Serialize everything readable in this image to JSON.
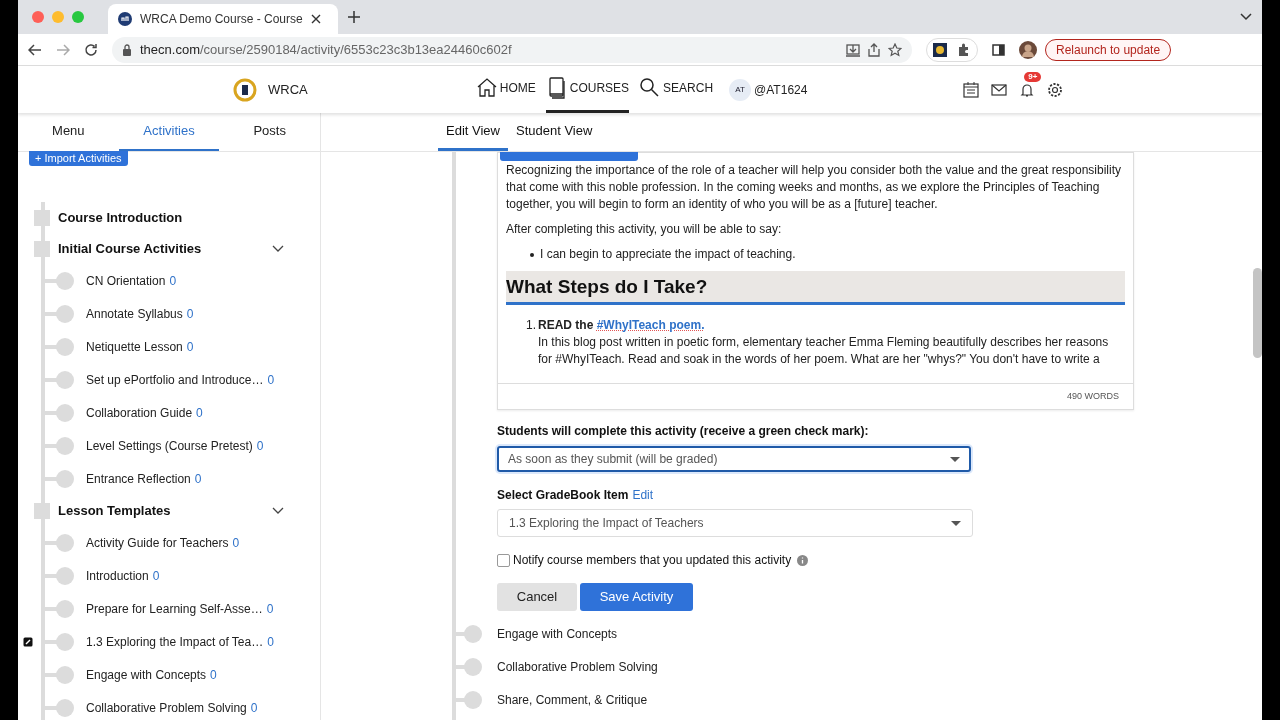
{
  "browser": {
    "tab_title": "WRCA Demo Course - Course",
    "url_host": "thecn.com",
    "url_path": "/course/2590184/activity/6553c23c3b13ea24460c602f",
    "relaunch_button": "Relaunch to update"
  },
  "header": {
    "logo_text": "WRCA",
    "nav": [
      {
        "kind": "home",
        "label": "HOME",
        "selected": false
      },
      {
        "kind": "courses",
        "label": "COURSES",
        "selected": true
      },
      {
        "kind": "search",
        "label": "SEARCH",
        "selected": false
      }
    ],
    "avatar_text": "AT",
    "handle": "@AT1624",
    "notification_badge": "9+"
  },
  "sidebar": {
    "tabs": [
      {
        "label": "Menu",
        "selected": false
      },
      {
        "label": "Activities",
        "selected": true
      },
      {
        "label": "Posts",
        "selected": false
      }
    ],
    "import_button": "+ Import Activities",
    "tree": [
      {
        "label": "Course Introduction",
        "expanded": false
      },
      {
        "label": "Initial Course Activities",
        "expanded": true,
        "children": [
          {
            "label": "CN Orientation",
            "count": "0",
            "editing": false
          },
          {
            "label": "Annotate Syllabus",
            "count": "0",
            "editing": false
          },
          {
            "label": "Netiquette Lesson",
            "count": "0",
            "editing": false
          },
          {
            "label": "Set up ePortfolio and Introduce…",
            "count": "0",
            "editing": false
          },
          {
            "label": "Collaboration Guide",
            "count": "0",
            "editing": false
          },
          {
            "label": "Level Settings (Course Pretest)",
            "count": "0",
            "editing": false
          },
          {
            "label": "Entrance Reflection",
            "count": "0",
            "editing": false
          }
        ]
      },
      {
        "label": "Lesson Templates",
        "expanded": true,
        "children": [
          {
            "label": "Activity Guide for Teachers",
            "count": "0",
            "editing": false
          },
          {
            "label": "Introduction",
            "count": "0",
            "editing": false
          },
          {
            "label": "Prepare for Learning Self-Asse…",
            "count": "0",
            "editing": false
          },
          {
            "label": "1.3 Exploring the Impact of Tea…",
            "count": "0",
            "editing": true
          },
          {
            "label": "Engage with Concepts",
            "count": "0",
            "editing": false
          },
          {
            "label": "Collaborative Problem Solving",
            "count": "0",
            "editing": false
          }
        ]
      }
    ]
  },
  "view_tabs": [
    {
      "label": "Edit View",
      "selected": true
    },
    {
      "label": "Student View",
      "selected": false
    }
  ],
  "editor": {
    "paragraph": "Recognizing the importance of the role of a teacher will help you consider both the value and the great responsibility that come with this noble profession. In the coming weeks and months, as we explore the Principles of Teaching together, you will begin to form an identity of who you will be as a [future] teacher.",
    "intro": "After completing this activity, you will be able to say:",
    "bullets": [
      "I can begin to appreciate the impact of teaching."
    ],
    "heading": "What Steps do I Take?",
    "steps": [
      {
        "number": "1.",
        "lead": "READ the",
        "link": "#WhyITeach poem.",
        "body": "In this blog post written in poetic form, elementary teacher Emma Fleming beautifully describes her reasons for #WhyITeach. Read and soak in the words of her poem. What are her \"whys?\" You don't have to write a"
      }
    ],
    "word_count": "490 WORDS"
  },
  "completion": {
    "label": "Students will complete this activity (receive a green check mark):",
    "value": "As soon as they submit (will be graded)",
    "focused": true
  },
  "gradebook": {
    "label": "Select GradeBook Item",
    "edit_link": "Edit",
    "value": "1.3 Exploring the Impact of Teachers",
    "focused": false
  },
  "notify": {
    "label": "Notify course members that you updated this activity",
    "checked": false
  },
  "buttons": {
    "cancel": "Cancel",
    "save": "Save Activity"
  },
  "outline": [
    "Engage with Concepts",
    "Collaborative Problem Solving",
    "Share, Comment, & Critique"
  ]
}
